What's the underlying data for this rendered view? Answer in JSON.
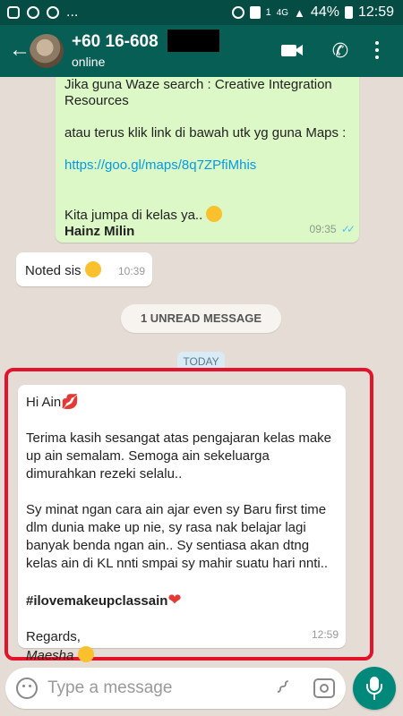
{
  "status_bar": {
    "text": "...",
    "sim": "1",
    "network": "4G",
    "battery": "44%",
    "time": "12:59"
  },
  "header": {
    "contact": "+60 16-608",
    "status": "online",
    "back_icon": "arrow-left-icon",
    "icons": [
      "video-call-icon",
      "phone-icon",
      "more-vert-icon"
    ]
  },
  "messages": {
    "outgoing": {
      "line1": "Jika guna Waze search  :  Creative Integration Resources",
      "line2": "atau terus klik link di bawah utk yg guna Maps :",
      "link": "https://goo.gl/maps/8q7ZPfiMhis",
      "line3": "Kita jumpa di kelas ya..",
      "sender": "Hainz Milin",
      "time": "09:35"
    },
    "noted": {
      "text": "Noted sis",
      "time": "10:39"
    },
    "unread_label": "1 UNREAD MESSAGE",
    "date_label": "TODAY",
    "incoming": {
      "greeting": "Hi Ain",
      "p1": "Terima kasih sesangat atas pengajaran kelas make up ain semalam. Semoga ain sekeluarga dimurahkan rezeki selalu..",
      "p2": "Sy minat ngan cara ain ajar even sy Baru first time dlm dunia make up nie, sy rasa nak belajar lagi banyak benda ngan ain.. Sy sentiasa akan dtng kelas ain di KL nnti smpai sy mahir suatu hari nnti..",
      "hashtag": "#ilovemakeupclassain",
      "regards": "Regards,",
      "signature": "Maesha",
      "time": "12:59"
    }
  },
  "input": {
    "placeholder": "Type a message"
  },
  "colors": {
    "header": "#075e54",
    "outgoing_bubble": "#dcf8c6",
    "incoming_bubble": "#ffffff",
    "highlight_border": "#e1142b",
    "mic_button": "#00897b"
  }
}
